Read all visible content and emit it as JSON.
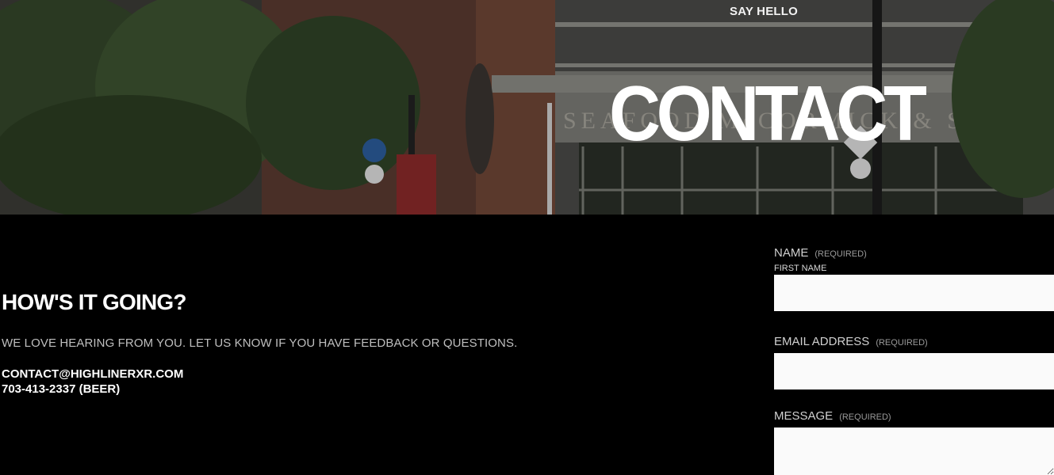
{
  "hero": {
    "eyebrow": "SAY HELLO",
    "title": "CONTACT"
  },
  "intro": {
    "heading": "HOW'S IT GOING?",
    "body": "WE LOVE HEARING FROM YOU. LET US KNOW IF YOU HAVE FEEDBACK OR QUESTIONS.",
    "email": "CONTACT@HIGHLINERXR.COM",
    "phone": "703-413-2337 (BEER)"
  },
  "form": {
    "name_label": "NAME",
    "name_required": "(REQUIRED)",
    "first_name_label": "FIRST NAME",
    "first_name_value": "",
    "email_label": "EMAIL ADDRESS",
    "email_required": "(REQUIRED)",
    "email_value": "",
    "message_label": "MESSAGE",
    "message_required": "(REQUIRED)",
    "message_value": ""
  },
  "colors": {
    "background": "#000000",
    "field_background": "#fafafa",
    "text_primary": "#ffffff",
    "text_muted": "#bfbfbf"
  }
}
